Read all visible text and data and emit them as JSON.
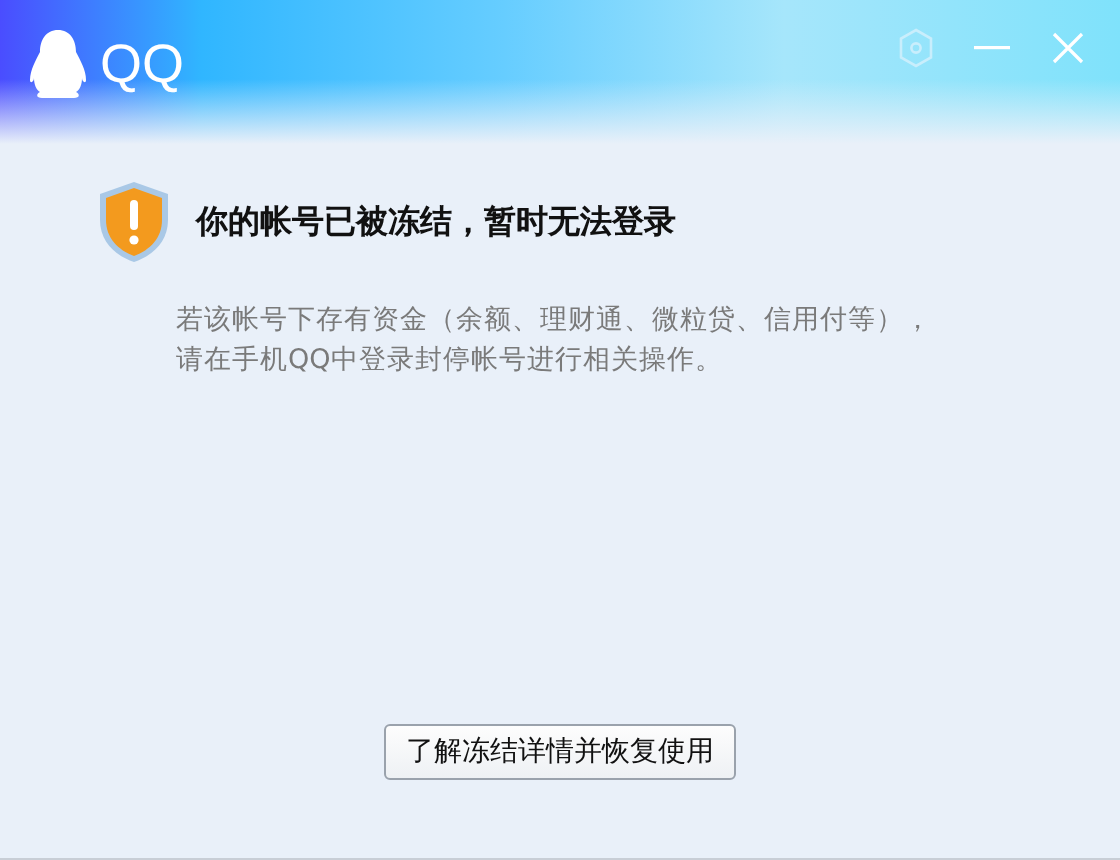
{
  "window": {
    "title": "QQ"
  },
  "notice": {
    "heading": "你的帐号已被冻结，暂时无法登录",
    "message": "若该帐号下存有资金（余额、理财通、微粒贷、信用付等），请在手机QQ中登录封停帐号进行相关操作。"
  },
  "buttons": [
    "了解冻结详情并恢复使用"
  ]
}
